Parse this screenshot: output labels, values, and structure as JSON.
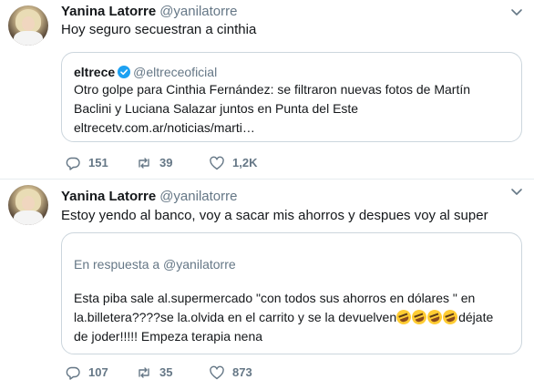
{
  "tweets": [
    {
      "name": "Yanina Latorre",
      "handle": "@yanilatorre",
      "text": "Hoy seguro secuestran a cinthia",
      "quote": {
        "name": "eltrece",
        "handle": "@eltreceoficial",
        "verified": true,
        "lines": [
          "Otro golpe para Cinthia Fernández: se filtraron nuevas fotos de Martín",
          "Baclini y Luciana Salazar juntos en Punta del Este",
          "eltrecetv.com.ar/noticias/marti…"
        ]
      },
      "actions": {
        "replies": "151",
        "retweets": "39",
        "likes": "1,2K"
      }
    },
    {
      "name": "Yanina Latorre",
      "handle": "@yanilatorre",
      "text": "Estoy yendo al banco, voy a sacar mis ahorros y despues voy al super",
      "quote": {
        "reply_to": "En respuesta a @yanilatorre",
        "lines": [
          "Esta piba sale al.supermercado \"con todos sus ahorros en dólares \" en",
          "la.billetera????se la.olvida en el carrito y se la devuelven",
          "déjate",
          "de joder!!!!! Empeza terapia nena"
        ]
      },
      "actions": {
        "replies": "107",
        "retweets": "35",
        "likes": "873"
      }
    }
  ],
  "icons": {
    "reply": "reply-icon",
    "retweet": "retweet-icon",
    "like": "heart-icon",
    "more": "chevron-down-icon",
    "verified": "verified-badge-icon",
    "emoji": "rolling-on-floor-laughing-emoji"
  },
  "colors": {
    "text": "#14171a",
    "secondary": "#657786",
    "border": "#ccd6dd",
    "verified": "#1da1f2"
  }
}
